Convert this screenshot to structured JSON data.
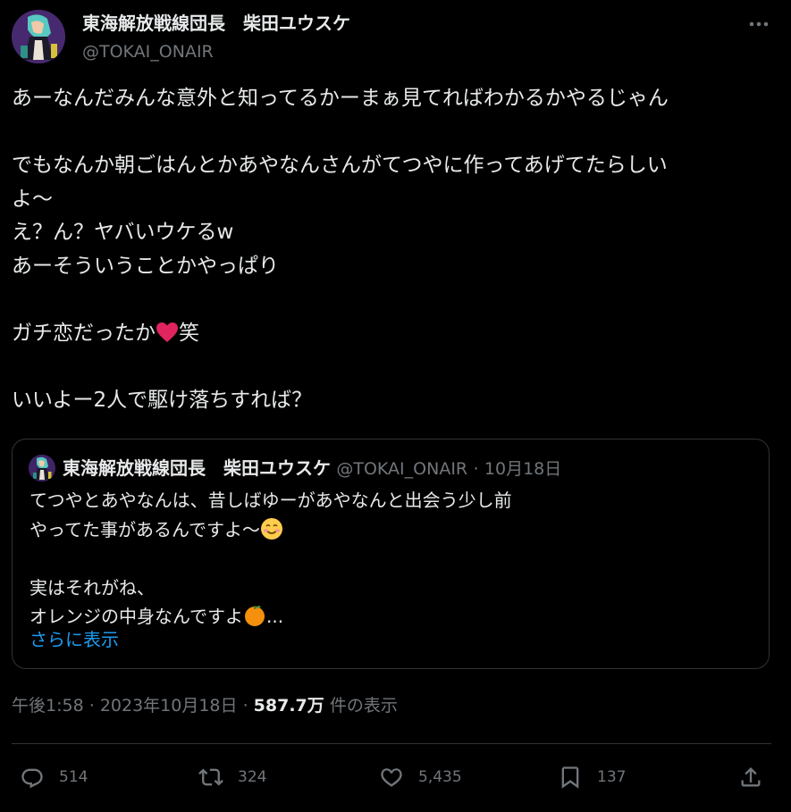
{
  "author": {
    "display_name": "東海解放戦線団長　柴田ユウスケ",
    "handle": "@TOKAI_ONAIR",
    "avatar_icon": "avatar-image"
  },
  "tweet": {
    "lines": [
      "あーなんだみんな意外と知ってるかーまぁ見てればわかるかやるじゃん",
      "",
      "でもなんか朝ごはんとかあやなんさんがてつやに作ってあげてたらしい",
      "よ〜",
      "え？ん？ヤバいウケるw",
      "あーそういうことかやっぱり",
      "",
      "ガチ恋だったか",
      "",
      "いいよー2人で駆け落ちすれば？"
    ],
    "heart_suffix": "笑"
  },
  "quote": {
    "display_name": "東海解放戦線団長　柴田ユウスケ",
    "handle": "@TOKAI_ONAIR",
    "separator": "·",
    "date": "10月18日",
    "lines": [
      "てつやとあやなんは、昔しばゆーがあやなんと出会う少し前",
      "やってた事があるんですよ〜",
      "",
      "実はそれがね、",
      "オレンジの中身なんですよ"
    ],
    "ellipsis": "...",
    "show_more": "さらに表示"
  },
  "meta": {
    "time": "午後1:58",
    "sep1": "·",
    "date": "2023年10月18日",
    "sep2": "·",
    "views": "587.7万",
    "views_label": "件の表示"
  },
  "actions": {
    "replies": "514",
    "retweets": "324",
    "likes": "5,435",
    "bookmarks": "137"
  },
  "colors": {
    "background": "#000000",
    "text": "#e7e9ea",
    "muted": "#71767b",
    "link": "#1d9bf0",
    "border": "#2f3336",
    "heart": "#e0245e"
  }
}
